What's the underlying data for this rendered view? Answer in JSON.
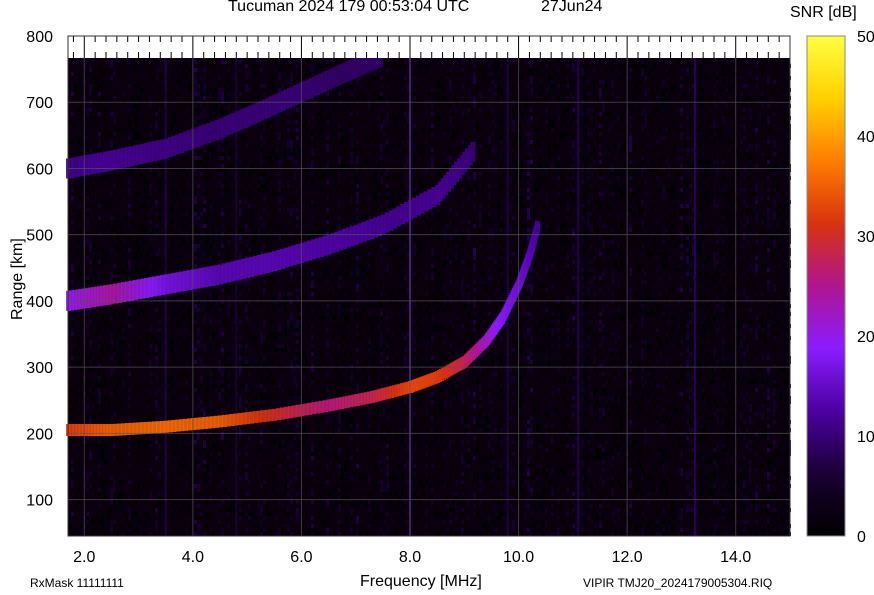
{
  "header": {
    "title": "Tucuman 2024 179 00:53:04 UTC",
    "date": "27Jun24"
  },
  "footer": {
    "rx_mask": "RxMask 11111111",
    "file": "VIPIR  TMJ20_2024179005304.RIQ"
  },
  "colorbar": {
    "label": "SNR [dB]",
    "ticks": [
      "0",
      "10",
      "20",
      "30",
      "40",
      "50"
    ],
    "range": [
      0,
      50
    ],
    "colors": [
      "#000000",
      "#1a0033",
      "#4b00a0",
      "#8a1cff",
      "#b0158f",
      "#d9320f",
      "#ff7d00",
      "#ffd000",
      "#ffff40"
    ]
  },
  "chart_data": {
    "type": "heatmap",
    "title": "Tucuman 2024 179 00:53:04 UTC",
    "xlabel": "Frequency [MHz]",
    "ylabel": "Range [km]",
    "xlim": [
      1.7,
      15.0
    ],
    "ylim": [
      45,
      800
    ],
    "x_ticks": [
      "2.0",
      "4.0",
      "6.0",
      "8.0",
      "10.0",
      "12.0",
      "14.0"
    ],
    "y_ticks": [
      "100",
      "200",
      "300",
      "400",
      "500",
      "600",
      "700",
      "800"
    ],
    "grid": true,
    "traces": [
      {
        "points": [
          [
            1.7,
            205
          ],
          [
            2.5,
            205
          ],
          [
            3.5,
            210
          ],
          [
            4.5,
            218
          ],
          [
            5.5,
            228
          ],
          [
            6.5,
            242
          ],
          [
            7.3,
            255
          ],
          [
            8.0,
            270
          ],
          [
            8.5,
            285
          ],
          [
            9.0,
            308
          ],
          [
            9.4,
            340
          ],
          [
            9.7,
            375
          ],
          [
            10.0,
            425
          ],
          [
            10.2,
            470
          ],
          [
            10.35,
            515
          ]
        ],
        "snr": [
          32,
          35,
          36,
          35,
          30,
          26,
          28,
          33,
          32,
          28,
          22,
          18,
          16,
          14,
          12
        ]
      },
      {
        "points": [
          [
            1.7,
            400
          ],
          [
            2.5,
            410
          ],
          [
            3.5,
            425
          ],
          [
            4.5,
            440
          ],
          [
            5.5,
            460
          ],
          [
            6.5,
            485
          ],
          [
            7.5,
            515
          ],
          [
            8.5,
            560
          ],
          [
            9.2,
            630
          ]
        ],
        "snr": [
          20,
          24,
          17,
          14,
          14,
          13,
          12,
          12,
          10
        ]
      },
      {
        "points": [
          [
            1.7,
            600
          ],
          [
            2.5,
            612
          ],
          [
            3.5,
            630
          ],
          [
            4.5,
            660
          ],
          [
            5.2,
            685
          ],
          [
            6.0,
            715
          ],
          [
            6.8,
            745
          ],
          [
            7.5,
            770
          ]
        ],
        "snr": [
          11,
          12,
          11,
          10,
          10,
          10,
          9,
          9
        ]
      }
    ]
  }
}
